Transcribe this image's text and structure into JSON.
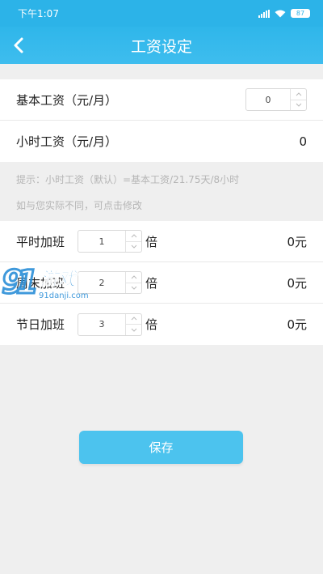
{
  "status_bar": {
    "time": "下午1:07",
    "battery": "87"
  },
  "header": {
    "title": "工资设定"
  },
  "salary": {
    "base_label": "基本工资（元/月）",
    "base_value": "0",
    "hourly_label": "小时工资（元/月）",
    "hourly_value": "0"
  },
  "hint": {
    "line1": "提示：小时工资（默认）=基本工资/21.75天/8小时",
    "line2": "如与您实际不同，可点击修改"
  },
  "overtime": {
    "multiplier_unit": "倍",
    "rows": [
      {
        "label": "平时加班",
        "multiplier": "1",
        "amount": "0元"
      },
      {
        "label": "周末加班",
        "multiplier": "2",
        "amount": "0元"
      },
      {
        "label": "节日加班",
        "multiplier": "3",
        "amount": "0元"
      }
    ]
  },
  "save_label": "保存",
  "watermark": {
    "brand": "91游戏",
    "site": "91danji.com"
  }
}
